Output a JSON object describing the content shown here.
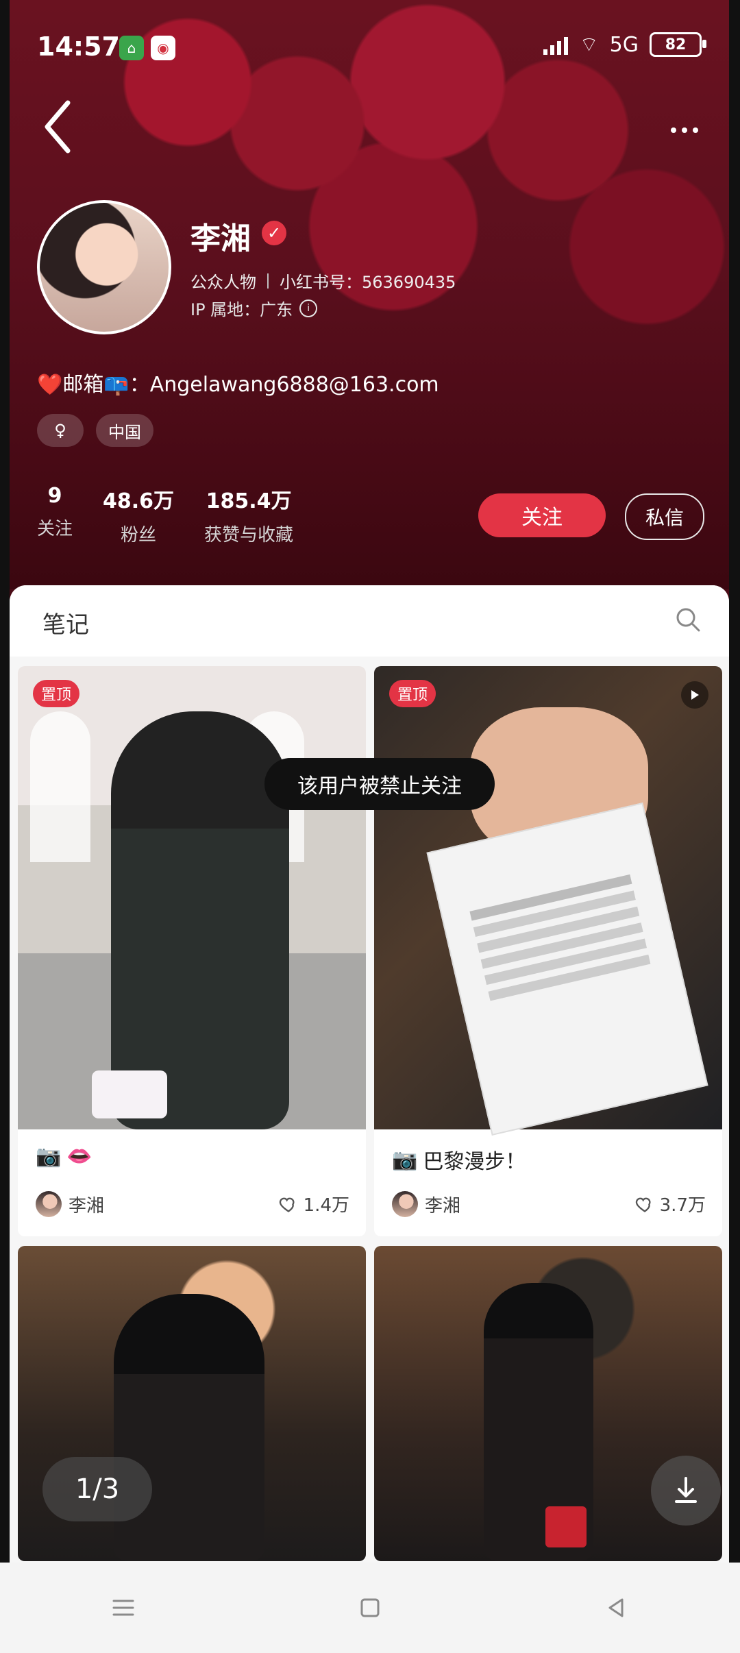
{
  "status": {
    "time": "14:57",
    "network": "5G",
    "battery": "82"
  },
  "profile": {
    "name": "李湘",
    "tag": "公众人物",
    "red_id": "小红书号：563690435",
    "ip": "IP 属地：广东",
    "bio": "❤️邮箱📪：Angelawang6888@163.com",
    "tags": [
      "♀",
      "中国"
    ]
  },
  "stats": [
    {
      "num": "9",
      "label": "关注"
    },
    {
      "num": "48.6万",
      "label": "粉丝"
    },
    {
      "num": "185.4万",
      "label": "获赞与收藏"
    }
  ],
  "actions": {
    "follow": "关注",
    "message": "私信"
  },
  "notes_tab": "笔记",
  "toast": "该用户被禁止关注",
  "posts": [
    {
      "pinned": "置顶",
      "caption_icon": "📷",
      "caption": "👄",
      "author": "李湘",
      "likes": "1.4万"
    },
    {
      "pinned": "置顶",
      "caption_icon": "📷",
      "caption": "巴黎漫步！",
      "author": "李湘",
      "likes": "3.7万"
    }
  ],
  "viewer": {
    "page": "1/3"
  },
  "nav": {
    "menu": "☰",
    "home": "▢",
    "back": "◁"
  }
}
